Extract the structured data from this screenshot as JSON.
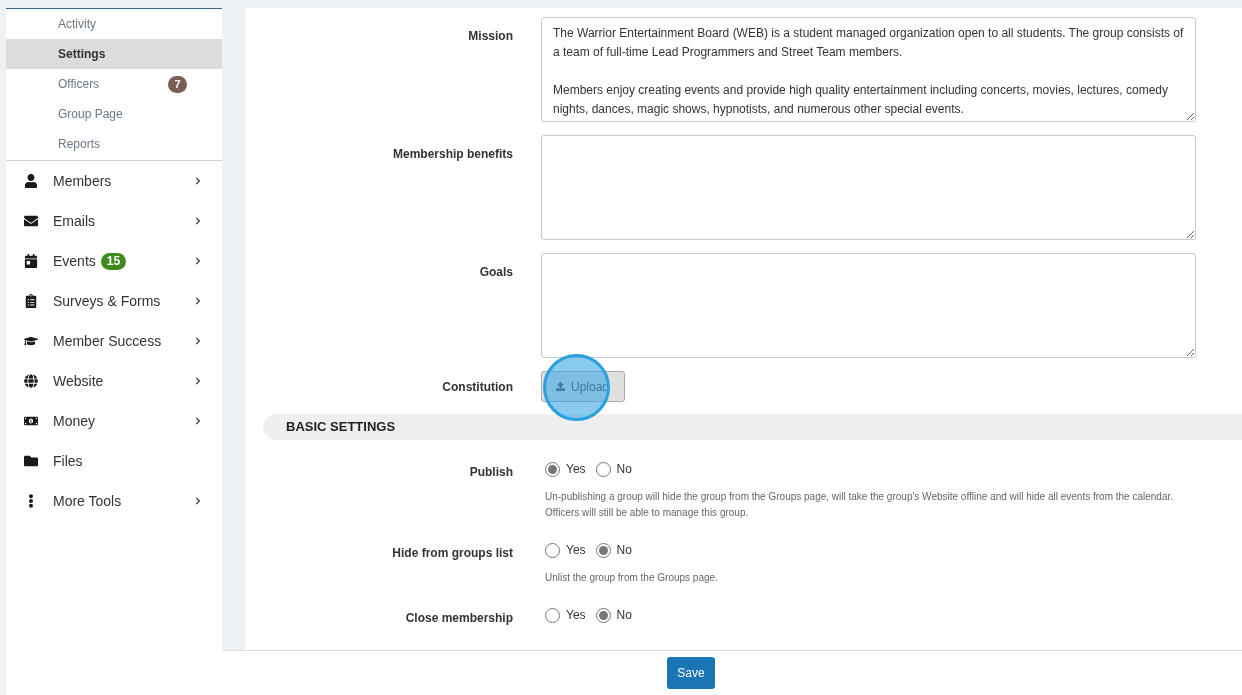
{
  "sidebar": {
    "subitems": [
      {
        "label": "Activity",
        "selected": false
      },
      {
        "label": "Settings",
        "selected": true
      },
      {
        "label": "Officers",
        "selected": false,
        "badge": "7",
        "color": "#7b5d55"
      },
      {
        "label": "Group Page",
        "selected": false
      },
      {
        "label": "Reports",
        "selected": false
      }
    ],
    "items": [
      {
        "label": "Members",
        "expandable": true
      },
      {
        "label": "Emails",
        "expandable": true
      },
      {
        "label": "Events",
        "expandable": true,
        "badge": "15",
        "color": "#3f8a1c"
      },
      {
        "label": "Surveys & Forms",
        "expandable": true
      },
      {
        "label": "Member Success",
        "expandable": true
      },
      {
        "label": "Website",
        "expandable": true
      },
      {
        "label": "Money",
        "expandable": true
      },
      {
        "label": "Files",
        "expandable": false
      },
      {
        "label": "More Tools",
        "expandable": true
      }
    ]
  },
  "fields": [
    {
      "label": "Mission",
      "value": "The Warrior Entertainment Board (WEB) is a student managed organization open to all students. The group consists of a team of full-time Lead Programmers and Street Team members.\n\nMembers enjoy creating events and provide high quality entertainment including concerts, movies, lectures, comedy nights, dances, magic shows, hypnotists, and numerous other special events."
    },
    {
      "label": "Membership benefits"
    },
    {
      "label": "Goals"
    }
  ],
  "constitution": {
    "label": "Constitution",
    "button": "Upload"
  },
  "basic_settings": {
    "title": "BASIC SETTINGS",
    "settings": [
      {
        "label": "Publish",
        "options": [
          {
            "label": "Yes",
            "selected": true
          },
          {
            "label": "No",
            "selected": false
          }
        ],
        "help": "Un-publishing a group will hide the group from the Groups page, will take the group's Website offline and will hide all events from the calendar. Officers will still be able to manage this group."
      },
      {
        "label": "Hide from groups list",
        "options": [
          {
            "label": "Yes",
            "selected": false
          },
          {
            "label": "No",
            "selected": true
          }
        ],
        "help": "Unlist the group from the Groups page."
      },
      {
        "label": "Close membership",
        "options": [
          {
            "label": "Yes",
            "selected": false
          },
          {
            "label": "No",
            "selected": true
          }
        ]
      }
    ]
  },
  "save_button": "Save"
}
